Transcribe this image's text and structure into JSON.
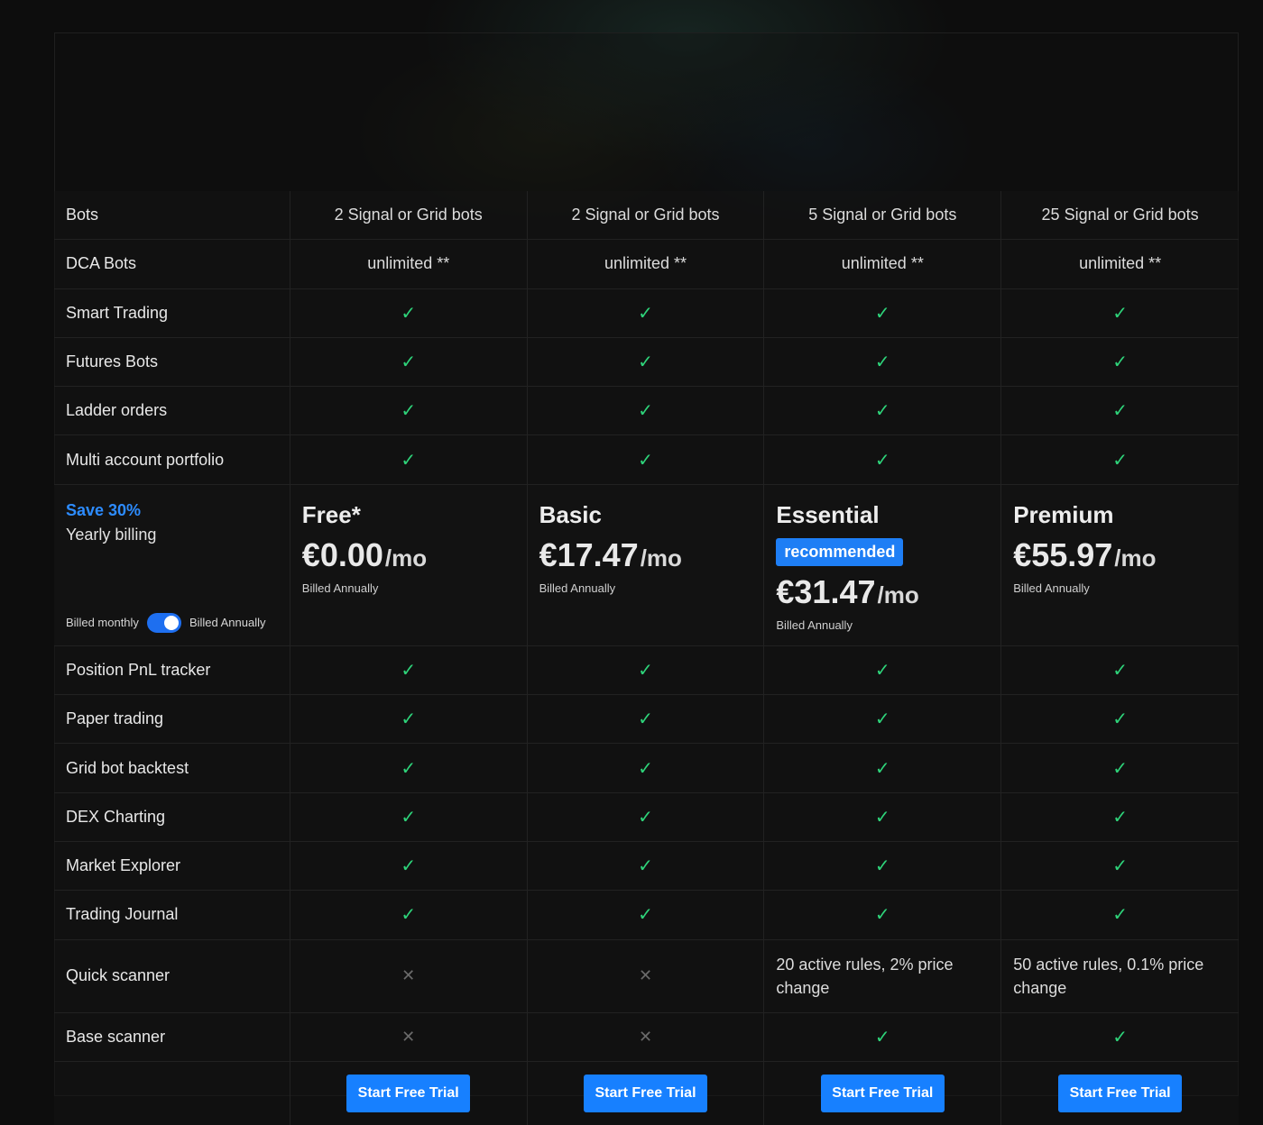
{
  "colors": {
    "accent": "#1780ff",
    "check": "#2ed47a",
    "save": "#2d8cff",
    "background": "#0d0d0d"
  },
  "top_rows": [
    {
      "label": "Bots",
      "values": [
        "2 Signal or Grid bots",
        "2 Signal or Grid bots",
        "5 Signal or Grid bots",
        "25 Signal or Grid bots"
      ]
    },
    {
      "label": "DCA Bots",
      "values": [
        "unlimited **",
        "unlimited **",
        "unlimited **",
        "unlimited **"
      ]
    },
    {
      "label": "Smart Trading",
      "values": [
        "check",
        "check",
        "check",
        "check"
      ]
    },
    {
      "label": "Futures Bots",
      "values": [
        "check",
        "check",
        "check",
        "check"
      ]
    },
    {
      "label": "Ladder orders",
      "values": [
        "check",
        "check",
        "check",
        "check"
      ]
    },
    {
      "label": "Multi account portfolio",
      "values": [
        "check",
        "check",
        "check",
        "check"
      ]
    }
  ],
  "billing": {
    "save_text": "Save 30%",
    "yearly_text": "Yearly billing",
    "toggle_left": "Billed monthly",
    "toggle_right": "Billed Annually",
    "annual_selected": true
  },
  "plans": [
    {
      "name": "Free*",
      "price": "€0.00",
      "period": "/mo",
      "billed": "Billed Annually",
      "badge": ""
    },
    {
      "name": "Basic",
      "price": "€17.47",
      "period": "/mo",
      "billed": "Billed Annually",
      "badge": ""
    },
    {
      "name": "Essential",
      "price": "€31.47",
      "period": "/mo",
      "billed": "Billed Annually",
      "badge": "recommended"
    },
    {
      "name": "Premium",
      "price": "€55.97",
      "period": "/mo",
      "billed": "Billed Annually",
      "badge": ""
    }
  ],
  "bottom_rows": [
    {
      "label": "Position PnL tracker",
      "values": [
        "check",
        "check",
        "check",
        "check"
      ]
    },
    {
      "label": "Paper trading",
      "values": [
        "check",
        "check",
        "check",
        "check"
      ]
    },
    {
      "label": "Grid bot backtest",
      "values": [
        "check",
        "check",
        "check",
        "check"
      ]
    },
    {
      "label": "DEX Charting",
      "values": [
        "check",
        "check",
        "check",
        "check"
      ]
    },
    {
      "label": "Market Explorer",
      "values": [
        "check",
        "check",
        "check",
        "check"
      ]
    },
    {
      "label": "Trading Journal",
      "values": [
        "check",
        "check",
        "check",
        "check"
      ]
    },
    {
      "label": "Quick scanner",
      "values": [
        "cross",
        "cross",
        "20 active rules, 2% price change",
        "50 active rules, 0.1% price change"
      ]
    },
    {
      "label": "Base scanner",
      "values": [
        "cross",
        "cross",
        "check",
        "check"
      ]
    }
  ],
  "cta": {
    "label": "Start Free Trial"
  },
  "icons": {
    "check": "check-icon",
    "cross": "cross-icon"
  }
}
